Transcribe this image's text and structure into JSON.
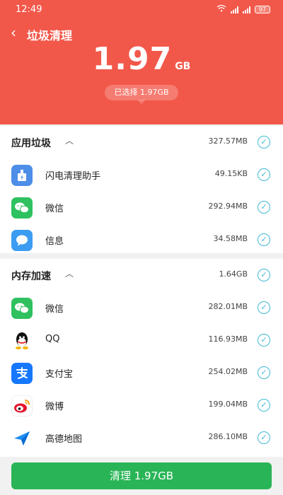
{
  "status": {
    "time": "12:49",
    "battery": "97"
  },
  "header": {
    "title": "垃圾清理",
    "total_size": "1.97",
    "total_unit": "GB",
    "selected_text": "已选择 1.97GB",
    "bg_color": "#f2584a"
  },
  "junk": {
    "section_title": "应用垃圾",
    "section_size": "327.57MB",
    "items": [
      {
        "label": "闪电清理助手",
        "size": "49.15KB",
        "icon": "flash-cleaner-icon"
      },
      {
        "label": "微信",
        "size": "292.94MB",
        "icon": "wechat-icon"
      },
      {
        "label": "信息",
        "size": "34.58MB",
        "icon": "messages-icon"
      }
    ]
  },
  "memory": {
    "section_title": "内存加速",
    "section_size": "1.64GB",
    "items": [
      {
        "label": "微信",
        "size": "282.01MB",
        "icon": "wechat-icon"
      },
      {
        "label": "QQ",
        "size": "116.93MB",
        "icon": "qq-icon"
      },
      {
        "label": "支付宝",
        "size": "254.02MB",
        "icon": "alipay-icon"
      },
      {
        "label": "微博",
        "size": "199.04MB",
        "icon": "weibo-icon"
      },
      {
        "label": "高德地图",
        "size": "286.10MB",
        "icon": "amap-icon"
      }
    ]
  },
  "clean_button": {
    "label": "清理 1.97GB",
    "color": "#29b557"
  }
}
